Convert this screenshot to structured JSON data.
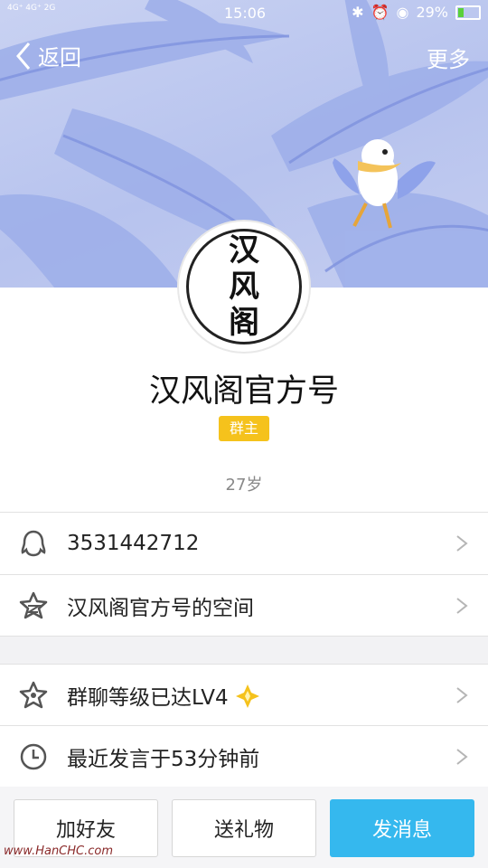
{
  "status_bar": {
    "time": "15:06",
    "battery": "29%",
    "signal_text": "4G⁺ 4G⁺ 2G"
  },
  "nav": {
    "back_label": "返回",
    "more_label": "更多"
  },
  "profile": {
    "avatar_text": [
      "汉",
      "风",
      "阁"
    ],
    "name": "汉风阁官方号",
    "badge": "群主",
    "age": "27岁"
  },
  "rows": [
    {
      "icon": "qq-penguin-icon",
      "label": "3531442712"
    },
    {
      "icon": "star-space-icon",
      "label": "汉风阁官方号的空间"
    },
    {
      "icon": "level-star-icon",
      "label": "群聊等级已达LV4"
    },
    {
      "icon": "clock-icon",
      "label": "最近发言于53分钟前"
    }
  ],
  "actions": {
    "add_friend": "加好友",
    "send_gift": "送礼物",
    "send_message": "发消息"
  },
  "watermark": "www.HanCHC.com",
  "colors": {
    "accent_blue": "#35b8ee",
    "badge_yellow": "#f5c21c",
    "banner": "#b7c3ee"
  }
}
